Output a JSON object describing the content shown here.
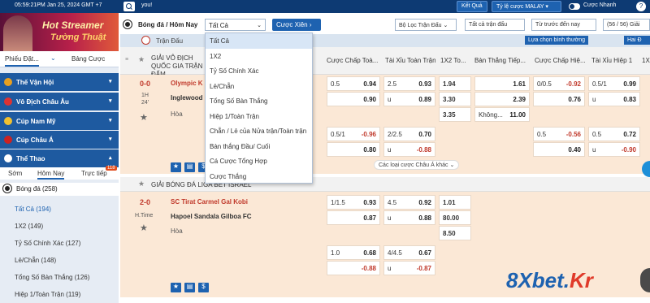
{
  "topbar": {
    "datetime": "05:59:21PM Jan 25, 2024 GMT +7",
    "search_text": "you!",
    "results_label": "Kết Quả",
    "odds_type_label": "Tỷ lệ cược MALAY",
    "odds_arrow": "▾",
    "quick_bet_label": "Cược Nhanh",
    "help_label": "?"
  },
  "sidebar": {
    "banner_title_1": "Hot Streamer",
    "banner_title_2": "Tường Thuật",
    "tabs": [
      "Phiếu Đặt...",
      "Bảng Cược"
    ],
    "tab_chevron": "⌄",
    "categories": [
      {
        "label": "Thế Vận Hội",
        "arrow": "▾"
      },
      {
        "label": "Vô Địch Châu Âu",
        "arrow": "▾"
      },
      {
        "label": "Cúp Nam Mỹ",
        "arrow": "▾"
      },
      {
        "label": "Cúp Châu Á",
        "arrow": "▾"
      },
      {
        "label": "Thể Thao",
        "arrow": "▴"
      }
    ],
    "sub_tabs": [
      "Sớm",
      "Hôm Nay",
      "Trực tiếp"
    ],
    "live_badge": "118",
    "sport_header": "Bóng đá",
    "sport_count": "(258)",
    "items": [
      {
        "label": "Tất Cả",
        "count": "(194)"
      },
      {
        "label": "1X2",
        "count": "(149)"
      },
      {
        "label": "Tỷ Số Chính Xác",
        "count": "(127)"
      },
      {
        "label": "Lẻ/Chẵn",
        "count": "(148)"
      },
      {
        "label": "Tổng Số Bàn Thắng",
        "count": "(126)"
      },
      {
        "label": "Hiệp 1/Toàn Trận",
        "count": "(119)"
      }
    ]
  },
  "main": {
    "title": "Bóng đá / Hôm Nay",
    "market_select": "Tất Cả",
    "select_arrow": "⌄",
    "combo_button": "Cược Xiên",
    "combo_arrow": "›",
    "filter_label": "Bộ Lọc Trận Đấu",
    "filter_arrow": "⌄",
    "all_matches_label": "Tất cả trận đấu",
    "order_label": "Từ trước đến nay",
    "count_label": "(56 / 56) Giải",
    "matches_header": "Trận Đấu",
    "view_option": "Lựa chọn bình thường",
    "view_option_short": "Hai Đ",
    "columns": [
      "Cược Chấp Toà...",
      "Tài Xỉu Toàn Trận",
      "1X2 To...",
      "Bàn Thắng Tiếp...",
      "Cược Chấp Hiệ...",
      "Tài Xỉu Hiệp 1",
      "1X2"
    ],
    "league1": "GIẢI VÔ ĐỊCH QUỐC GIA TRẬN ĐẤM",
    "league1_icon": "≡",
    "league2": "GIẢI BÓNG ĐÁ LIGA BET ISRAEL",
    "more_markets": "Các loại cược Châu Á khác",
    "more_arrow": "⌄",
    "star": "★",
    "match1": {
      "score": "0-0",
      "half": "1H",
      "minute": "24'",
      "home": "Olympic K",
      "away": "Inglewood",
      "draw": "Hòa",
      "rows": [
        {
          "ah_line": "0.5",
          "ah_odds": "0.94",
          "ou_line": "2.5",
          "ou_odds": "0.93",
          "x12": "1.94",
          "next": "",
          "next_odds": "1.61",
          "ah1_line": "0/0.5",
          "ah1_odds": "-0.92",
          "ou1_line": "0.5/1",
          "ou1_odds": "0.99"
        },
        {
          "ah_line": "",
          "ah_odds": "0.90",
          "ou_line": "u",
          "ou_odds": "0.89",
          "x12": "3.30",
          "next": "",
          "next_odds": "2.39",
          "ah1_line": "",
          "ah1_odds": "0.76",
          "ou1_line": "u",
          "ou1_odds": "0.83"
        },
        {
          "ah_line": "",
          "ah_odds": "",
          "ou_line": "",
          "ou_odds": "",
          "x12": "3.35",
          "next": "Không...",
          "next_odds": "11.00",
          "ah1_line": "",
          "ah1_odds": "",
          "ou1_line": "",
          "ou1_odds": ""
        },
        {
          "ah_line": "0.5/1",
          "ah_odds": "-0.96",
          "ou_line": "2/2.5",
          "ou_odds": "0.70",
          "x12": "",
          "next": "",
          "next_odds": "",
          "ah1_line": "0.5",
          "ah1_odds": "-0.56",
          "ou1_line": "0.5",
          "ou1_odds": "0.72"
        },
        {
          "ah_line": "",
          "ah_odds": "0.80",
          "ou_line": "u",
          "ou_odds": "-0.88",
          "x12": "",
          "next": "",
          "next_odds": "",
          "ah1_line": "",
          "ah1_odds": "0.40",
          "ou1_line": "u",
          "ou1_odds": "-0.90"
        }
      ]
    },
    "match2": {
      "score": "2-0",
      "half": "H.Time",
      "home": "SC Tirat Carmel Gal Kobi",
      "away": "Hapoel Sandala Gilboa FC",
      "draw": "Hòa",
      "rows": [
        {
          "ah_line": "1/1.5",
          "ah_odds": "0.93",
          "ou_line": "4.5",
          "ou_odds": "0.92",
          "x12": "1.01"
        },
        {
          "ah_line": "",
          "ah_odds": "0.87",
          "ou_line": "u",
          "ou_odds": "0.88",
          "x12": "80.00"
        },
        {
          "ah_line": "",
          "ah_odds": "",
          "ou_line": "",
          "ou_odds": "",
          "x12": "8.50"
        },
        {
          "ah_line": "1.0",
          "ah_odds": "0.68",
          "ou_line": "4/4.5",
          "ou_odds": "0.67"
        },
        {
          "ah_line": "",
          "ah_odds": "-0.88",
          "ou_line": "u",
          "ou_odds": "-0.87"
        }
      ]
    },
    "row_icons": [
      "★",
      "▤",
      "$"
    ]
  },
  "dropdown": {
    "options": [
      "Tất Cả",
      "1X2",
      "Tỷ Số Chính Xác",
      "Lẻ/Chẵn",
      "Tổng Số Bàn Thắng",
      "Hiệp 1/Toàn Trận",
      "Chẵn / Lẻ của Nửa trận/Toàn trận",
      "Bàn thắng Đầu/ Cuối",
      "Cá Cược Tổng Hợp",
      "Cược Thắng"
    ]
  },
  "watermark": {
    "main": "8Xbet.",
    "accent": "Kr"
  },
  "colors": {
    "navy": "#0d3a73",
    "accent": "#1e62b0",
    "red": "#c0392b",
    "match_bg": "#fbe8d6"
  }
}
